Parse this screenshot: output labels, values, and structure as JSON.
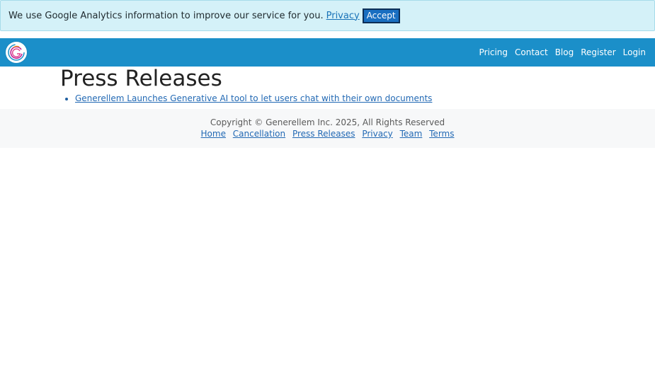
{
  "cookie_banner": {
    "message": "We use Google Analytics information to improve our service for you.",
    "privacy_link": "Privacy",
    "accept_label": "Accept"
  },
  "navbar": {
    "logo_icon": "generellem-logo-icon",
    "links": [
      "Pricing",
      "Contact",
      "Blog",
      "Register",
      "Login"
    ]
  },
  "main": {
    "title": "Press Releases",
    "releases": [
      "Generellem Launches Generative AI tool to let users chat with their own documents"
    ]
  },
  "footer": {
    "copyright": "Copyright © Generellem Inc. 2025, All Rights Reserved",
    "links": [
      "Home",
      "Cancellation",
      "Press Releases",
      "Privacy",
      "Team",
      "Terms"
    ]
  },
  "colors": {
    "nav_bg": "#1b8fc9",
    "banner_bg": "#d4f1f8",
    "accept_bg": "#1a6fc1",
    "link": "#2269b4"
  }
}
